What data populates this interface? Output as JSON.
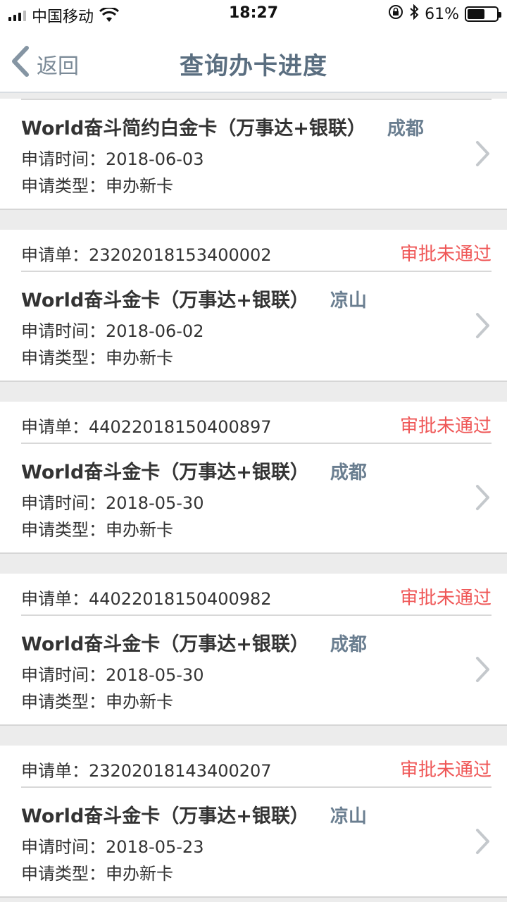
{
  "status_bar": {
    "carrier": "中国移动",
    "time": "18:27",
    "battery_percent_text": "61%",
    "battery_level": 0.61
  },
  "nav": {
    "back_label": "返回",
    "title": "查询办卡进度"
  },
  "first_card": {
    "name": "World奋斗简约白金卡（万事达+银联）",
    "city": "成都",
    "time_line": "申请时间：2018-06-03",
    "type_line": "申请类型：申办新卡"
  },
  "cards": [
    {
      "order": "申请单：23202018153400002",
      "status": "审批未通过",
      "name": "World奋斗金卡（万事达+银联）",
      "city": "凉山",
      "time_line": "申请时间：2018-06-02",
      "type_line": "申请类型：申办新卡"
    },
    {
      "order": "申请单：44022018150400897",
      "status": "审批未通过",
      "name": "World奋斗金卡（万事达+银联）",
      "city": "成都",
      "time_line": "申请时间：2018-05-30",
      "type_line": "申请类型：申办新卡"
    },
    {
      "order": "申请单：44022018150400982",
      "status": "审批未通过",
      "name": "World奋斗金卡（万事达+银联）",
      "city": "成都",
      "time_line": "申请时间：2018-05-30",
      "type_line": "申请类型：申办新卡"
    },
    {
      "order": "申请单：23202018143400207",
      "status": "审批未通过",
      "name": "World奋斗金卡（万事达+银联）",
      "city": "凉山",
      "time_line": "申请时间：2018-05-23",
      "type_line": "申请类型：申办新卡"
    }
  ],
  "colors": {
    "status_rejected": "#ef5757",
    "city": "#6a7e90",
    "nav_title": "#5a6e80"
  }
}
